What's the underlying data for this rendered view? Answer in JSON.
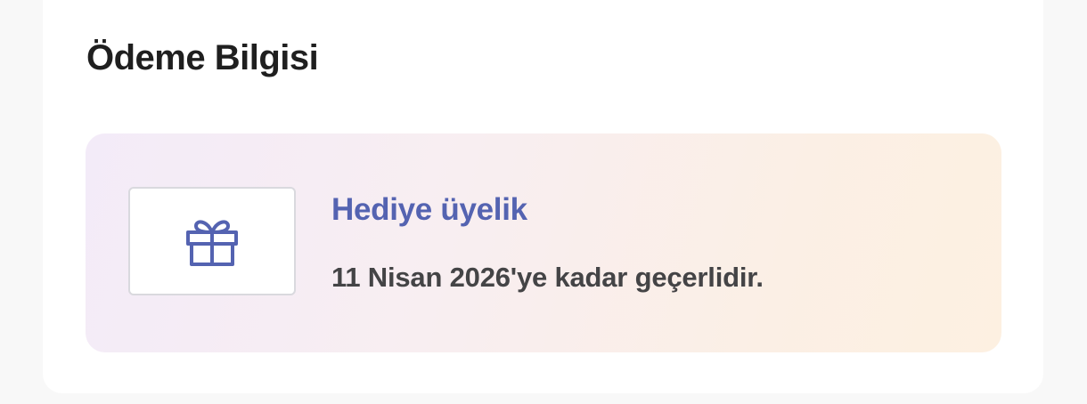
{
  "payment": {
    "title": "Ödeme Bilgisi",
    "membership": {
      "icon": "gift-icon",
      "type_label": "Hediye üyelik",
      "validity_text": "11 Nisan 2026'ye kadar geçerlidir."
    }
  },
  "colors": {
    "accent": "#5463b1",
    "title_text": "#1f1f1f",
    "body_text": "#444446",
    "box_gradient_start": "#f3ebf8",
    "box_gradient_end": "#fdf0e1"
  }
}
